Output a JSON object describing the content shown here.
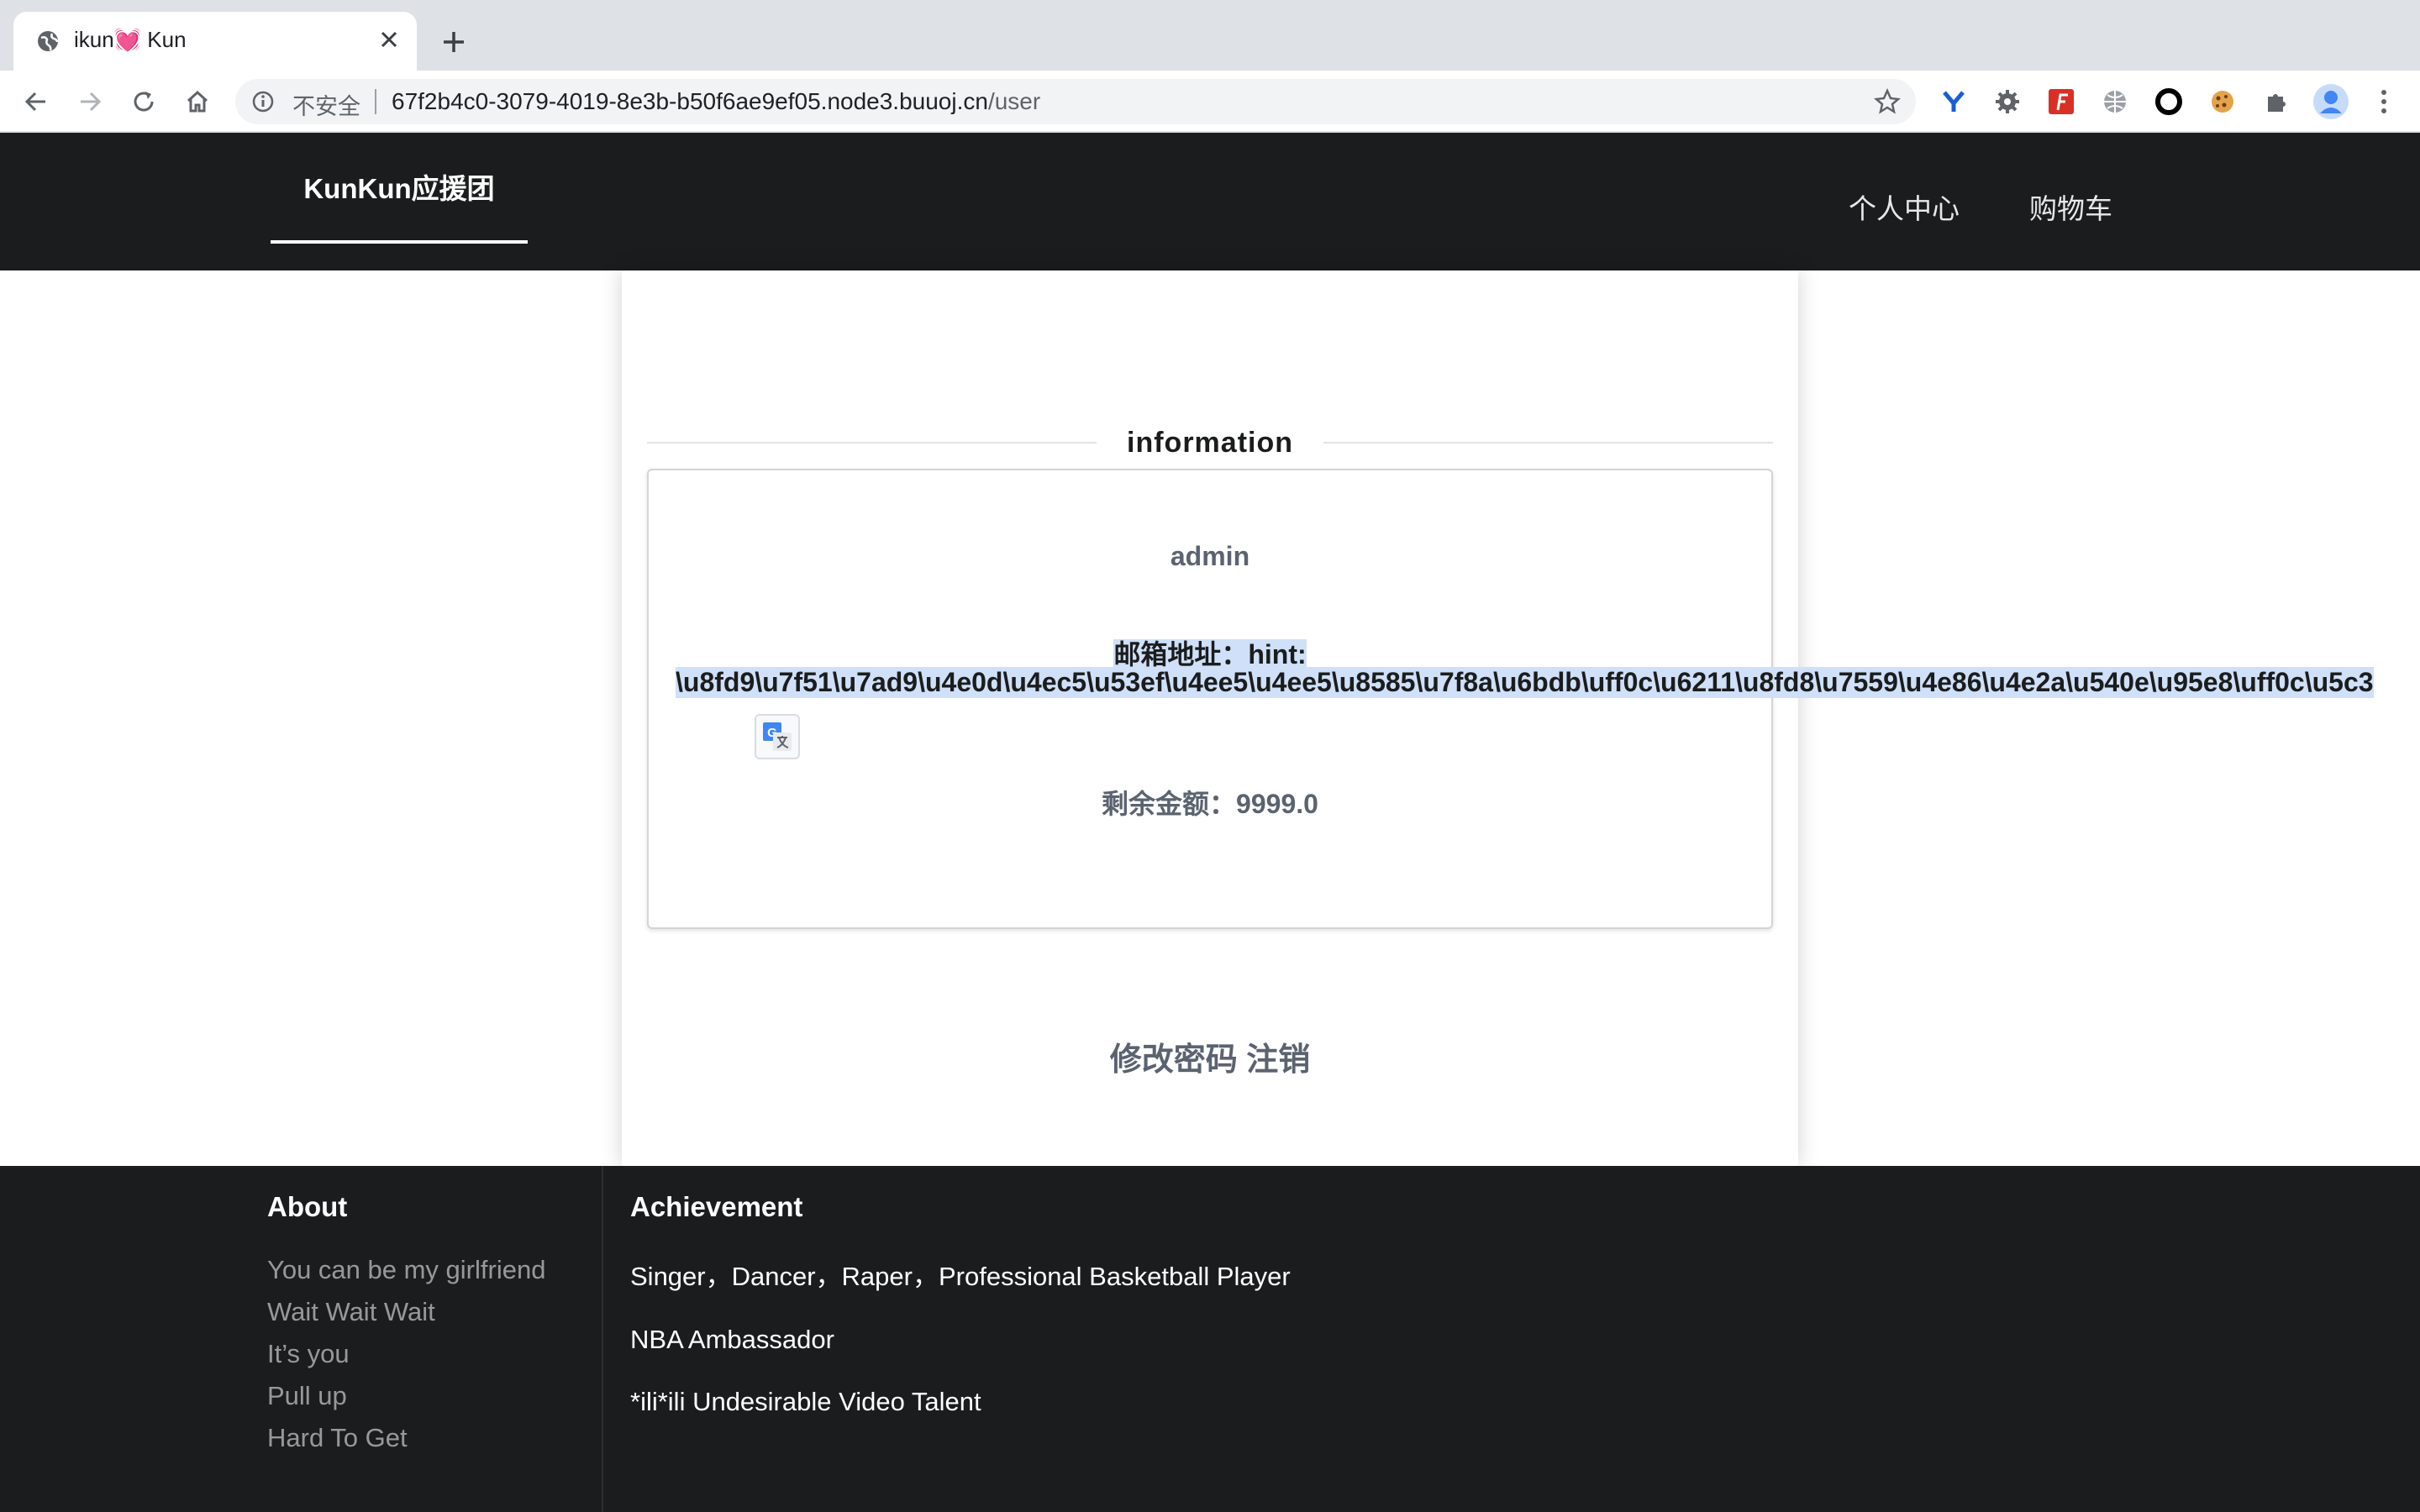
{
  "browser": {
    "tab_title": "ikun💓 Kun",
    "insecure_label": "不安全",
    "url_host": "67f2b4c0-3079-4019-8e3b-b50f6ae9ef05.node3.buuoj.cn",
    "url_path": "/user",
    "icons": [
      "back-icon",
      "forward-icon",
      "reload-icon",
      "home-icon",
      "info-icon",
      "star-icon",
      "puzzle-icon",
      "profile-icon",
      "menu-icon"
    ]
  },
  "header": {
    "brand": "KunKun应援团",
    "nav": [
      "个人中心",
      "购物车"
    ]
  },
  "main": {
    "section_title": "information",
    "username": "admin",
    "email_label": "邮箱地址：hint:",
    "hint_text": "\\u8fd9\\u7f51\\u7ad9\\u4e0d\\u4ec5\\u53ef\\u4ee5\\u4ee5\\u8585\\u7f8a\\u6bdb\\uff0c\\u6211\\u8fd8\\u7559\\u4e86\\u4e2a\\u540e\\u95e8\\uff0c\\u5c3",
    "balance": "剩余金额：9999.0",
    "change_password": "修改密码",
    "logout": "注销"
  },
  "footer": {
    "about_title": "About",
    "about_links": [
      "You can be my girlfriend",
      "Wait Wait Wait",
      "It’s you",
      "Pull up",
      "Hard To Get"
    ],
    "achievement_title": "Achievement",
    "achievements": [
      "Singer，Dancer，Raper，Professional Basketball Player",
      "NBA Ambassador",
      "*ili*ili Undesirable Video Talent"
    ]
  },
  "colors": {
    "header_bg": "#1b1c1d",
    "selection": "#cfe0f8",
    "muted_text": "#5b6370"
  }
}
